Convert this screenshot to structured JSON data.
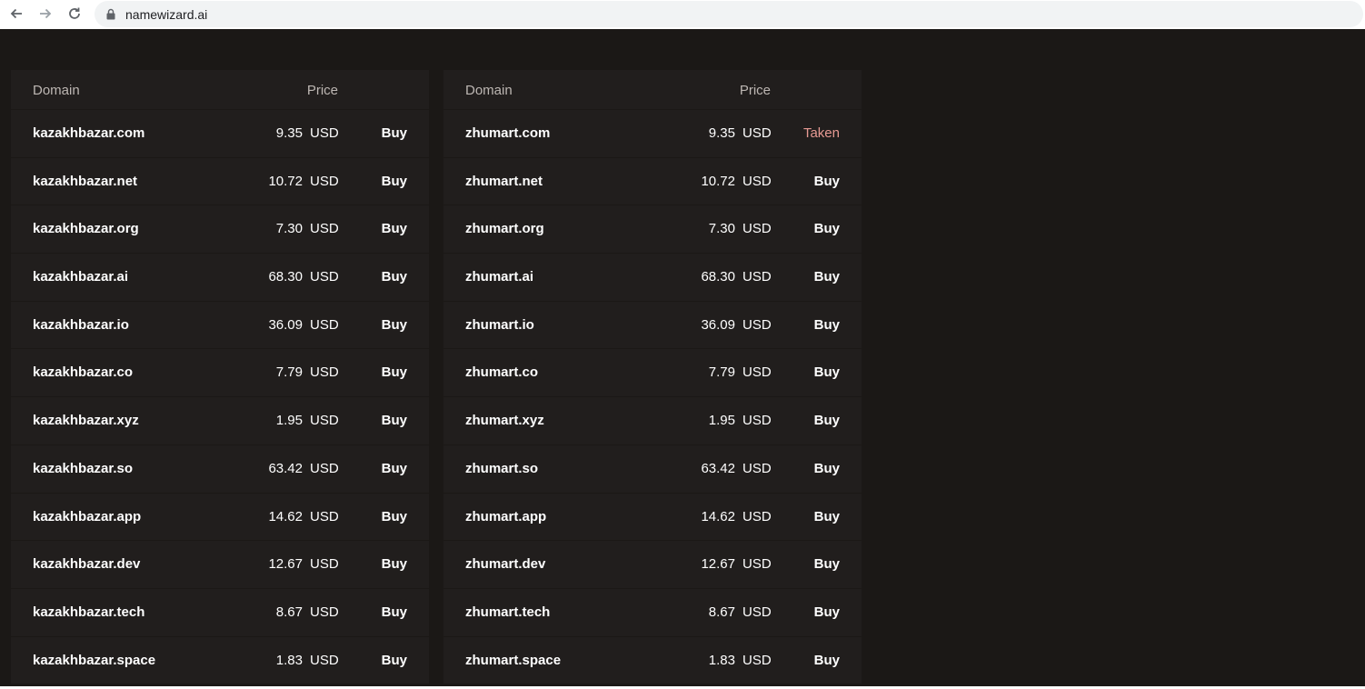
{
  "browser": {
    "url": "namewizard.ai"
  },
  "colors": {
    "background": "#1b1816",
    "panel": "#211e1d",
    "taken": "#e79a93"
  },
  "tables": [
    {
      "header": {
        "domain": "Domain",
        "price": "Price"
      },
      "rows": [
        {
          "domain": "kazakhbazar.com",
          "price": "9.35",
          "currency": "USD",
          "action": "Buy"
        },
        {
          "domain": "kazakhbazar.net",
          "price": "10.72",
          "currency": "USD",
          "action": "Buy"
        },
        {
          "domain": "kazakhbazar.org",
          "price": "7.30",
          "currency": "USD",
          "action": "Buy"
        },
        {
          "domain": "kazakhbazar.ai",
          "price": "68.30",
          "currency": "USD",
          "action": "Buy"
        },
        {
          "domain": "kazakhbazar.io",
          "price": "36.09",
          "currency": "USD",
          "action": "Buy"
        },
        {
          "domain": "kazakhbazar.co",
          "price": "7.79",
          "currency": "USD",
          "action": "Buy"
        },
        {
          "domain": "kazakhbazar.xyz",
          "price": "1.95",
          "currency": "USD",
          "action": "Buy"
        },
        {
          "domain": "kazakhbazar.so",
          "price": "63.42",
          "currency": "USD",
          "action": "Buy"
        },
        {
          "domain": "kazakhbazar.app",
          "price": "14.62",
          "currency": "USD",
          "action": "Buy"
        },
        {
          "domain": "kazakhbazar.dev",
          "price": "12.67",
          "currency": "USD",
          "action": "Buy"
        },
        {
          "domain": "kazakhbazar.tech",
          "price": "8.67",
          "currency": "USD",
          "action": "Buy"
        },
        {
          "domain": "kazakhbazar.space",
          "price": "1.83",
          "currency": "USD",
          "action": "Buy"
        }
      ]
    },
    {
      "header": {
        "domain": "Domain",
        "price": "Price"
      },
      "rows": [
        {
          "domain": "zhumart.com",
          "price": "9.35",
          "currency": "USD",
          "action": "Taken"
        },
        {
          "domain": "zhumart.net",
          "price": "10.72",
          "currency": "USD",
          "action": "Buy"
        },
        {
          "domain": "zhumart.org",
          "price": "7.30",
          "currency": "USD",
          "action": "Buy"
        },
        {
          "domain": "zhumart.ai",
          "price": "68.30",
          "currency": "USD",
          "action": "Buy"
        },
        {
          "domain": "zhumart.io",
          "price": "36.09",
          "currency": "USD",
          "action": "Buy"
        },
        {
          "domain": "zhumart.co",
          "price": "7.79",
          "currency": "USD",
          "action": "Buy"
        },
        {
          "domain": "zhumart.xyz",
          "price": "1.95",
          "currency": "USD",
          "action": "Buy"
        },
        {
          "domain": "zhumart.so",
          "price": "63.42",
          "currency": "USD",
          "action": "Buy"
        },
        {
          "domain": "zhumart.app",
          "price": "14.62",
          "currency": "USD",
          "action": "Buy"
        },
        {
          "domain": "zhumart.dev",
          "price": "12.67",
          "currency": "USD",
          "action": "Buy"
        },
        {
          "domain": "zhumart.tech",
          "price": "8.67",
          "currency": "USD",
          "action": "Buy"
        },
        {
          "domain": "zhumart.space",
          "price": "1.83",
          "currency": "USD",
          "action": "Buy"
        }
      ]
    }
  ]
}
